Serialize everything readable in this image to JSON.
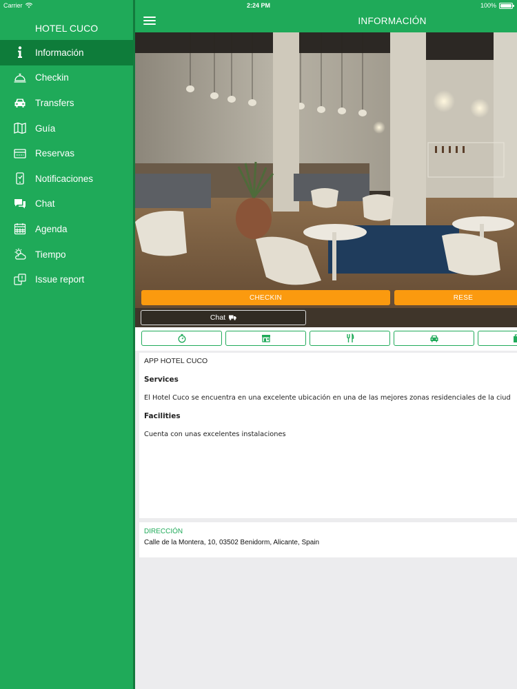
{
  "status_bar": {
    "carrier": "Carrier",
    "time": "2:24 PM",
    "battery": "100%",
    "battery_level": 1.0
  },
  "sidebar": {
    "app_name": "HOTEL CUCO",
    "items": [
      {
        "label": "Información",
        "icon": "info-icon",
        "active": true
      },
      {
        "label": "Checkin",
        "icon": "service-bell-icon"
      },
      {
        "label": "Transfers",
        "icon": "car-icon"
      },
      {
        "label": "Guía",
        "icon": "map-icon"
      },
      {
        "label": "Reservas",
        "icon": "ticket-icon"
      },
      {
        "label": "Notificaciones",
        "icon": "phone-notification-icon"
      },
      {
        "label": "Chat",
        "icon": "chat-bubbles-icon"
      },
      {
        "label": "Agenda",
        "icon": "calendar-icon"
      },
      {
        "label": "Tiempo",
        "icon": "weather-icon"
      },
      {
        "label": "Issue report",
        "icon": "issue-report-icon"
      }
    ]
  },
  "header": {
    "title": "INFORMACIÓN",
    "menu_icon": "hamburger-icon"
  },
  "hero": {
    "buttons": {
      "checkin": "CHECKIN",
      "reservas": "RESE"
    },
    "chat": {
      "label": "Chat",
      "icon": "truck-icon"
    }
  },
  "icon_bar": [
    "stopwatch-icon",
    "shop-icon",
    "fork-knife-icon",
    "taxi-icon",
    "bag-icon"
  ],
  "info": {
    "app_title": "APP HOTEL CUCO",
    "services_heading": "Services",
    "services_text": "El Hotel Cuco se encuentra en una excelente ubicación en una de las mejores zonas residenciales de la ciud",
    "facilities_heading": "Facilities",
    "facilities_text": "Cuenta con unas excelentes instalaciones"
  },
  "address": {
    "label": "DIRECCIÓN",
    "value": "Calle de la Montera, 10, 03502 Benidorm, Alicante, Spain"
  },
  "colors": {
    "brand_green": "#1faa59",
    "active_green": "#0e7c3a",
    "orange": "#fb9a0f",
    "background": "#ececee"
  }
}
